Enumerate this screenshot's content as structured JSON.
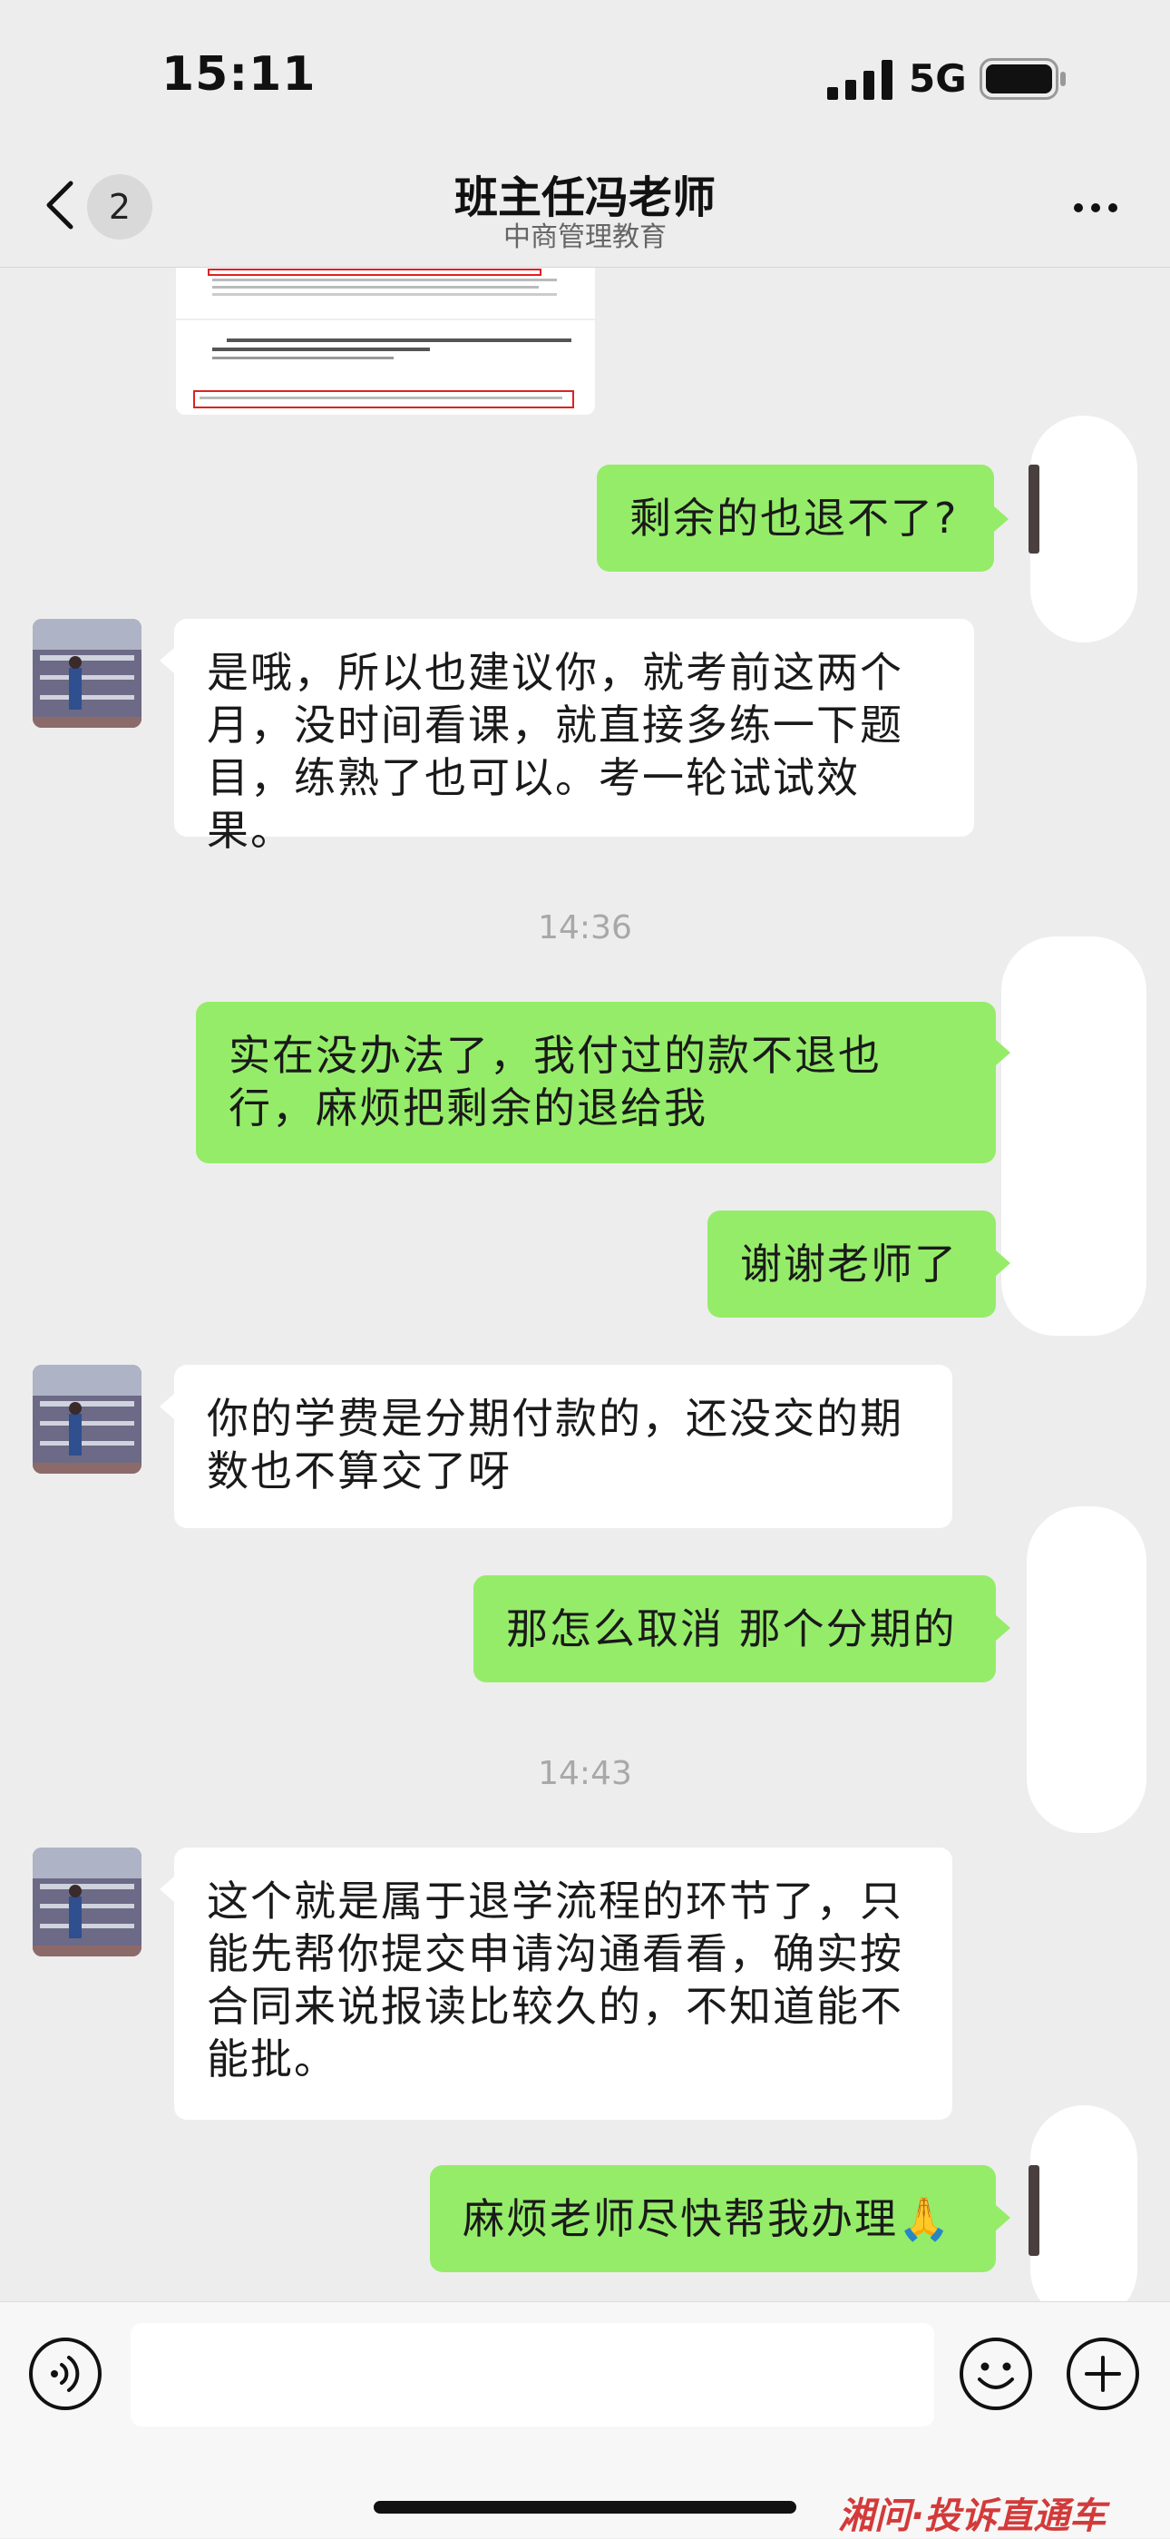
{
  "status_bar": {
    "time": "15:11",
    "network": "5G"
  },
  "nav": {
    "unread_count": "2",
    "title": "班主任冯老师",
    "subtitle": "中商管理教育"
  },
  "messages": [
    {
      "side": "right",
      "text": "剩余的也退不了?"
    },
    {
      "side": "left",
      "text": "是哦，所以也建议你，就考前这两个月，没时间看课，就直接多练一下题目，练熟了也可以。考一轮试试效果。"
    },
    {
      "side": "right",
      "text": "实在没办法了，我付过的款不退也行，麻烦把剩余的退给我"
    },
    {
      "side": "right",
      "text": "谢谢老师了"
    },
    {
      "side": "left",
      "text": "你的学费是分期付款的，还没交的期数也不算交了呀"
    },
    {
      "side": "right",
      "text": "那怎么取消 那个分期的"
    },
    {
      "side": "left",
      "text": "这个就是属于退学流程的环节了，只能先帮你提交申请沟通看看，确实按合同来说报读比较久的，不知道能不能批。"
    },
    {
      "side": "right",
      "text": "麻烦老师尽快帮我办理🙏"
    }
  ],
  "timestamps": [
    "14:36",
    "14:43"
  ],
  "watermark": "湘问·投诉直通车",
  "icons": {
    "back": "chevron-left-icon",
    "more": "more-dots-icon",
    "voice": "voice-icon",
    "emoji": "emoji-icon",
    "plus": "plus-icon",
    "signal": "signal-icon",
    "battery": "battery-icon"
  },
  "colors": {
    "bubble_self": "#95ec69",
    "bubble_other": "#ffffff",
    "background": "#ededed"
  }
}
